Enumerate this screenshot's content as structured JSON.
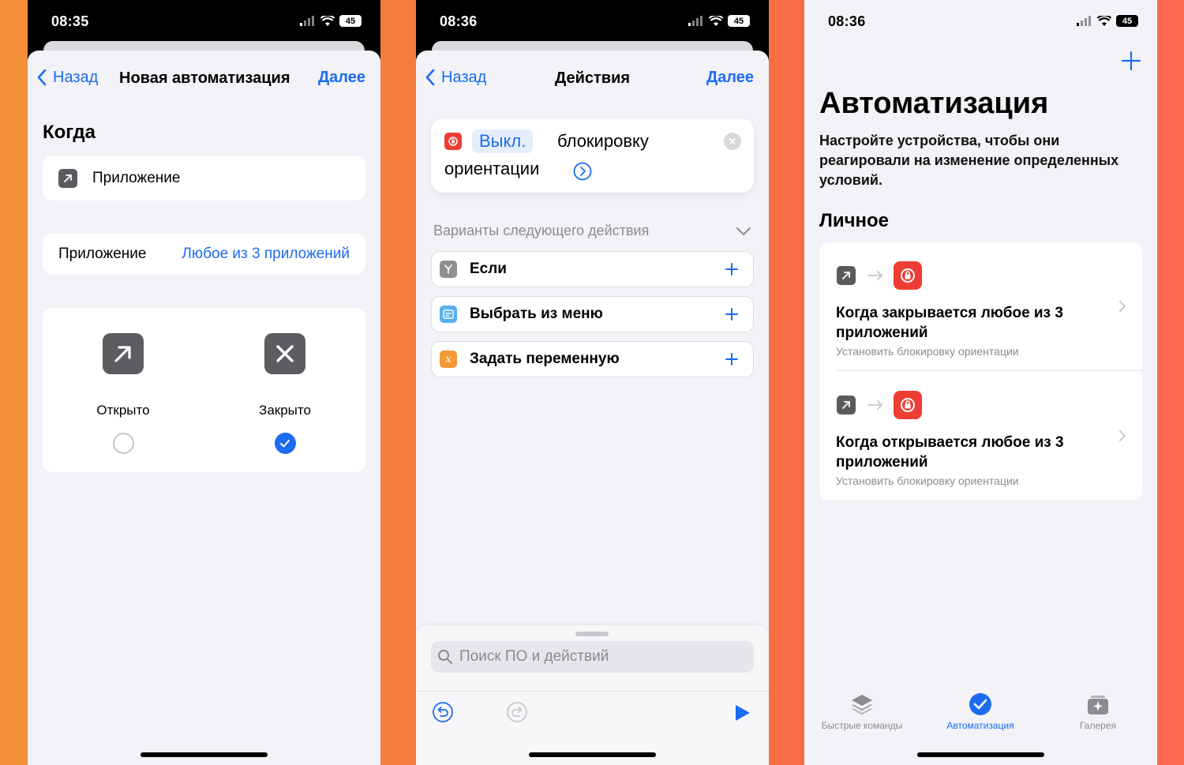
{
  "status": {
    "time1": "08:35",
    "time2": "08:36",
    "time3": "08:36",
    "battery": "45"
  },
  "screen1": {
    "back": "Назад",
    "title": "Новая автоматизация",
    "next": "Далее",
    "section": "Когда",
    "trigger": "Приложение",
    "app_label": "Приложение",
    "app_value": "Любое из 3 приложений",
    "opened": "Открыто",
    "closed": "Закрыто"
  },
  "screen2": {
    "back": "Назад",
    "title": "Действия",
    "next": "Далее",
    "action_token": "Выкл.",
    "action_text1": "блокировку",
    "action_text2": "ориентации",
    "suggest_header": "Варианты следующего действия",
    "suggestions": [
      {
        "label": "Если",
        "color": "#8e8e93"
      },
      {
        "label": "Выбрать из меню",
        "color": "#5ab0f0"
      },
      {
        "label": "Задать переменную",
        "color": "#f39a36"
      }
    ],
    "search_placeholder": "Поиск ПО и действий"
  },
  "screen3": {
    "title": "Автоматизация",
    "subtitle": "Настройте устройства, чтобы они реагировали на изменение определенных условий.",
    "section": "Личное",
    "automations": [
      {
        "title": "Когда закрывается любое из 3 приложений",
        "sub": "Установить блокировку ориентации"
      },
      {
        "title": "Когда открывается любое из 3 приложений",
        "sub": "Установить блокировку ориентации"
      }
    ],
    "tabs": [
      {
        "label": "Быстрые команды",
        "active": false
      },
      {
        "label": "Автоматизация",
        "active": true
      },
      {
        "label": "Галерея",
        "active": false
      }
    ]
  },
  "colors": {
    "accent": "#1b6cf2",
    "red": "#ee3e34",
    "gray_icon": "#5a5a5f",
    "background": "#f2f2f7"
  }
}
